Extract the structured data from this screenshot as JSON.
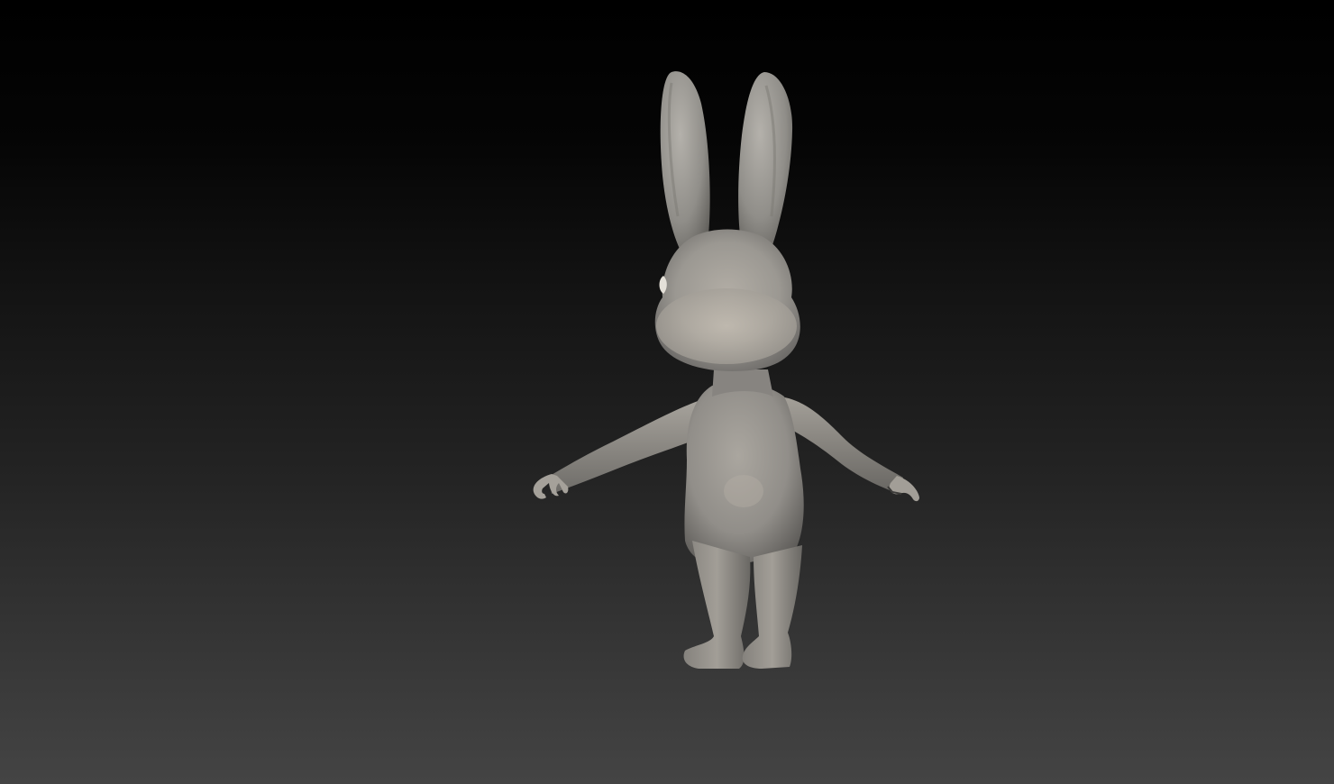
{
  "viewport": {
    "background_top": "#000000",
    "background_bottom": "#444444"
  },
  "model": {
    "subject": "rabbit-character",
    "material_color": "#9a9893",
    "shadow_color": "#5f5d59",
    "highlight_color": "#c2bdb4"
  }
}
